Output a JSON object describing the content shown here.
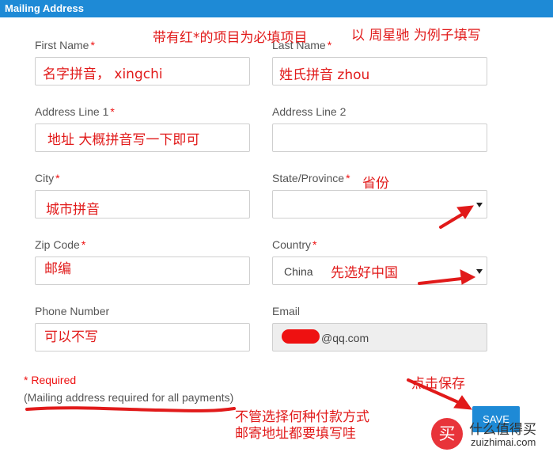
{
  "header": {
    "title": "Mailing Address"
  },
  "form": {
    "first_name": {
      "label": "First Name",
      "req": "*",
      "value": ""
    },
    "last_name": {
      "label": "Last Name",
      "req": "*",
      "value": ""
    },
    "address1": {
      "label": "Address Line 1",
      "req": "*",
      "value": ""
    },
    "address2": {
      "label": "Address Line 2",
      "value": ""
    },
    "city": {
      "label": "City",
      "req": "*",
      "value": ""
    },
    "state": {
      "label": "State/Province",
      "req": "*",
      "value": ""
    },
    "zip": {
      "label": "Zip Code",
      "req": "*",
      "value": ""
    },
    "country": {
      "label": "Country",
      "req": "*",
      "value": "China"
    },
    "phone": {
      "label": "Phone Number",
      "value": ""
    },
    "email": {
      "label": "Email",
      "value": "@qq.com"
    }
  },
  "notes": {
    "required": "* Required",
    "mailing": "(Mailing address required for all payments)"
  },
  "save_label": "SAVE",
  "annotations": {
    "top_note": "带有红*的项目为必填项目",
    "example": "以 周星驰 为例子填写",
    "first_name": "名字拼音， xingchi",
    "last_name": "姓氏拼音 zhou",
    "address": "地址 大概拼音写一下即可",
    "state": "省份",
    "city": "城市拼音",
    "zip": "邮编",
    "country": "先选好中国",
    "phone": "可以不写",
    "save": "点击保存",
    "payment_line1": "不管选择何种付款方式",
    "payment_line2": "邮寄地址都要填写哇"
  },
  "brand": {
    "icon": "买",
    "title": "什么值得买",
    "domain": "zuizhimai.com"
  },
  "colors": {
    "accent": "#1e8ad6",
    "required": "#e11a1a"
  }
}
